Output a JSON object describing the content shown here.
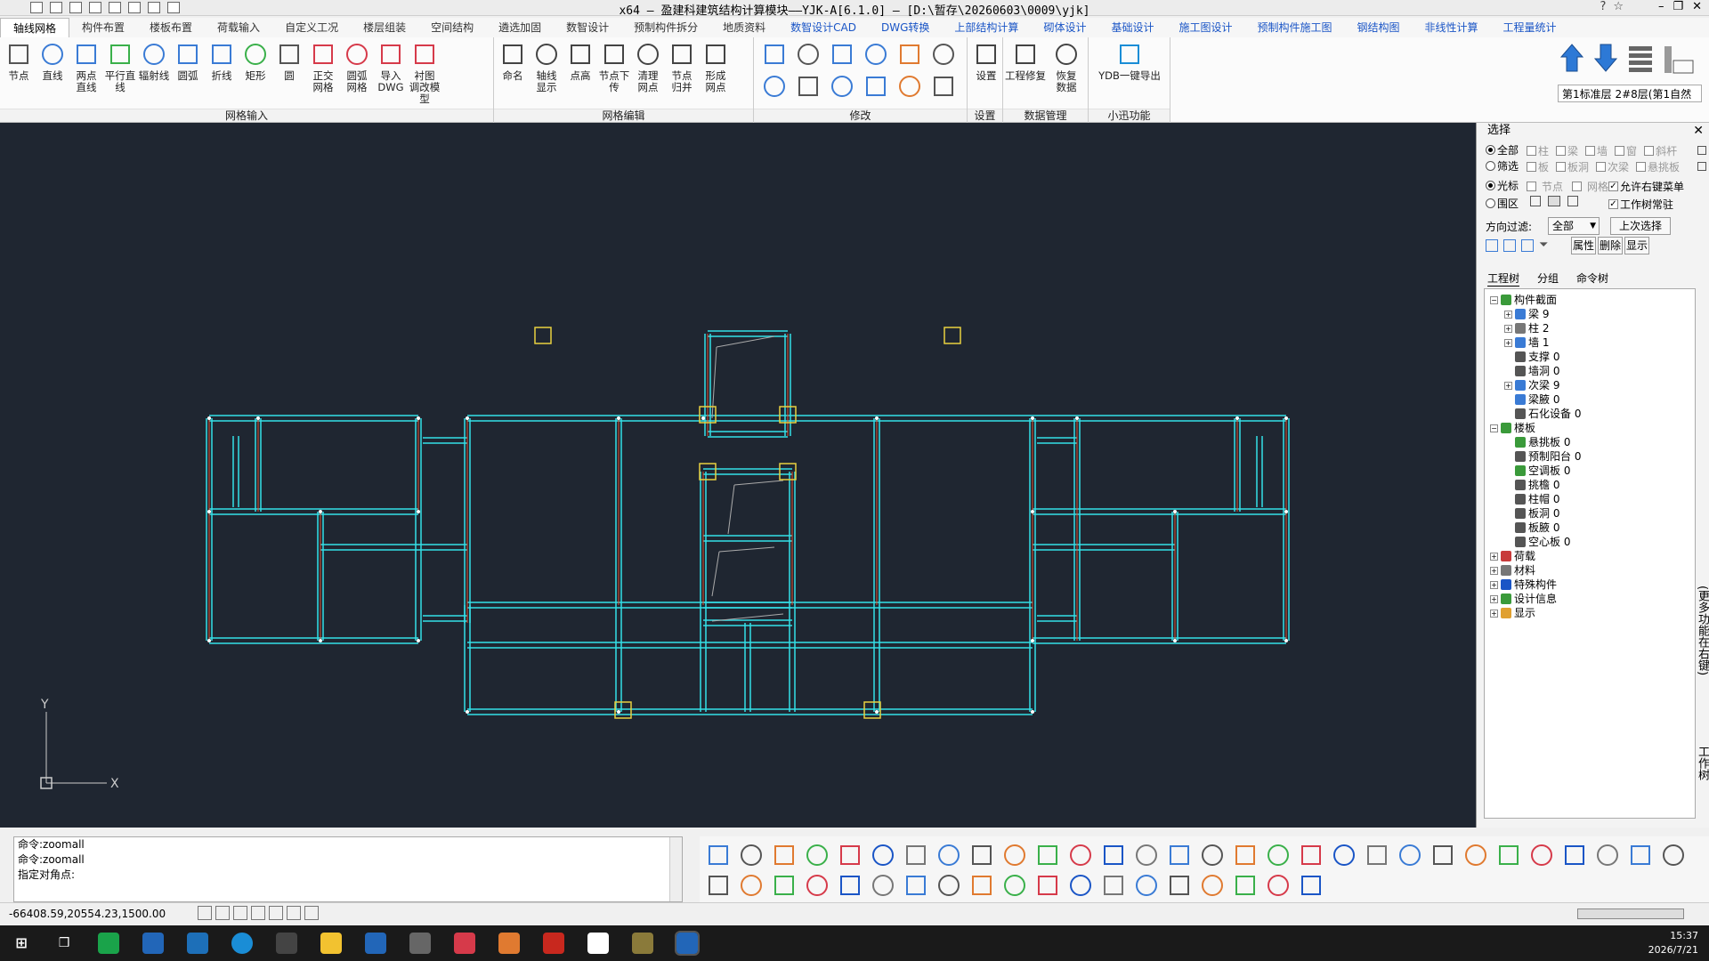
{
  "window": {
    "title": "x64 – 盈建科建筑结构计算模块——YJK-A[6.1.0] – [D:\\暂存\\20260603\\0009\\yjk]",
    "controls": [
      "minimize",
      "restore",
      "close"
    ]
  },
  "menu_tabs": [
    {
      "label": "轴线网格",
      "active": true,
      "style": "normal"
    },
    {
      "label": "构件布置",
      "style": "normal"
    },
    {
      "label": "楼板布置",
      "style": "normal"
    },
    {
      "label": "荷载输入",
      "style": "normal"
    },
    {
      "label": "自定义工况",
      "style": "normal"
    },
    {
      "label": "楼层组装",
      "style": "normal"
    },
    {
      "label": "空间结构",
      "style": "normal"
    },
    {
      "label": "遴选加固",
      "style": "normal"
    },
    {
      "label": "数智设计",
      "style": "normal"
    },
    {
      "label": "预制构件拆分",
      "style": "normal"
    },
    {
      "label": "地质资料",
      "style": "normal"
    },
    {
      "label": "数智设计CAD",
      "style": "blue"
    },
    {
      "label": "DWG转换",
      "style": "blue"
    },
    {
      "label": "上部结构计算",
      "style": "blue"
    },
    {
      "label": "砌体设计",
      "style": "blue"
    },
    {
      "label": "基础设计",
      "style": "blue"
    },
    {
      "label": "施工图设计",
      "style": "blue"
    },
    {
      "label": "预制构件施工图",
      "style": "blue"
    },
    {
      "label": "钢结构图",
      "style": "blue"
    },
    {
      "label": "非线性计算",
      "style": "blue"
    },
    {
      "label": "工程量统计",
      "style": "blue"
    }
  ],
  "ribbon": {
    "groups": [
      {
        "label": "网格输入",
        "tools": [
          "节点",
          "直线",
          "两点\n直线",
          "平行直线",
          "辐射线",
          "圆弧",
          "折线",
          "矩形",
          "圆",
          "正交\n网格",
          "圆弧\n网格",
          "导入\nDWG",
          "衬图\n调改模型"
        ]
      },
      {
        "label": "网格编辑",
        "tools": [
          "命名",
          "轴线\n显示",
          "点高",
          "节点下传",
          "清理\n网点",
          "节点\n归并",
          "形成\n网点"
        ]
      },
      {
        "label": "修改",
        "tools": []
      },
      {
        "label": "设置",
        "tools": [
          "设置"
        ]
      },
      {
        "label": "数据管理",
        "tools": [
          "工程修复",
          "恢复\n数据"
        ]
      },
      {
        "label": "小迅功能",
        "tools": [
          "YDB一键导出"
        ]
      }
    ],
    "floor_selector": "第1标准层 2#8层(第1自然"
  },
  "panel": {
    "title": "选择",
    "modes": [
      {
        "label": "全部",
        "selected": true
      },
      {
        "label": "筛选",
        "selected": false
      }
    ],
    "type_filters_row1": [
      "柱",
      "梁",
      "墙",
      "窗",
      "斜杆"
    ],
    "type_filters_row2": [
      "板",
      "板洞",
      "次梁",
      "悬挑板"
    ],
    "pick_modes": [
      {
        "label": "光标",
        "selected": true
      },
      {
        "label": "围区",
        "selected": false
      }
    ],
    "pick_row_opts": [
      "节点",
      "网格"
    ],
    "allow_right_menu": "允许右键菜单",
    "tree_resident": "工作树常驻",
    "direction_filter_label": "方向过滤:",
    "direction_filter_value": "全部",
    "prev_select": "上次选择",
    "actions": [
      "属性",
      "删除",
      "显示"
    ],
    "tree_tabs": [
      "工程树",
      "分组",
      "命令树"
    ],
    "tree": [
      {
        "label": "构件截面",
        "level": 0,
        "expander": "−"
      },
      {
        "label": "梁 9",
        "level": 1,
        "expander": "+"
      },
      {
        "label": "柱 2",
        "level": 1,
        "expander": "+"
      },
      {
        "label": "墙 1",
        "level": 1,
        "expander": "+"
      },
      {
        "label": "支撑 0",
        "level": 1,
        "expander": ""
      },
      {
        "label": "墙洞 0",
        "level": 1,
        "expander": ""
      },
      {
        "label": "次梁 9",
        "level": 1,
        "expander": "+"
      },
      {
        "label": "梁腋 0",
        "level": 1,
        "expander": ""
      },
      {
        "label": "石化设备 0",
        "level": 1,
        "expander": ""
      },
      {
        "label": "楼板",
        "level": 0,
        "expander": "−"
      },
      {
        "label": "悬挑板 0",
        "level": 1,
        "expander": ""
      },
      {
        "label": "预制阳台 0",
        "level": 1,
        "expander": ""
      },
      {
        "label": "空调板 0",
        "level": 1,
        "expander": ""
      },
      {
        "label": "挑檐 0",
        "level": 1,
        "expander": ""
      },
      {
        "label": "柱帽 0",
        "level": 1,
        "expander": ""
      },
      {
        "label": "板洞 0",
        "level": 1,
        "expander": ""
      },
      {
        "label": "板腋 0",
        "level": 1,
        "expander": ""
      },
      {
        "label": "空心板 0",
        "level": 1,
        "expander": ""
      },
      {
        "label": "荷载",
        "level": 0,
        "expander": "+"
      },
      {
        "label": "材料",
        "level": 0,
        "expander": "+"
      },
      {
        "label": "特殊构件",
        "level": 0,
        "expander": "+"
      },
      {
        "label": "设计信息",
        "level": 0,
        "expander": "+"
      },
      {
        "label": "显示",
        "level": 0,
        "expander": "+"
      }
    ],
    "side_labels": [
      "(更多功能在右键)",
      "工作树"
    ]
  },
  "command": {
    "lines": [
      "命令:zoomall",
      "命令:zoomall",
      "指定对角点:"
    ]
  },
  "status": {
    "coords": "-66408.59,20554.23,1500.00"
  },
  "axis": {
    "x": "X",
    "y": "Y"
  },
  "taskbar": {
    "time": "15:37",
    "date": "2026/7/21"
  }
}
